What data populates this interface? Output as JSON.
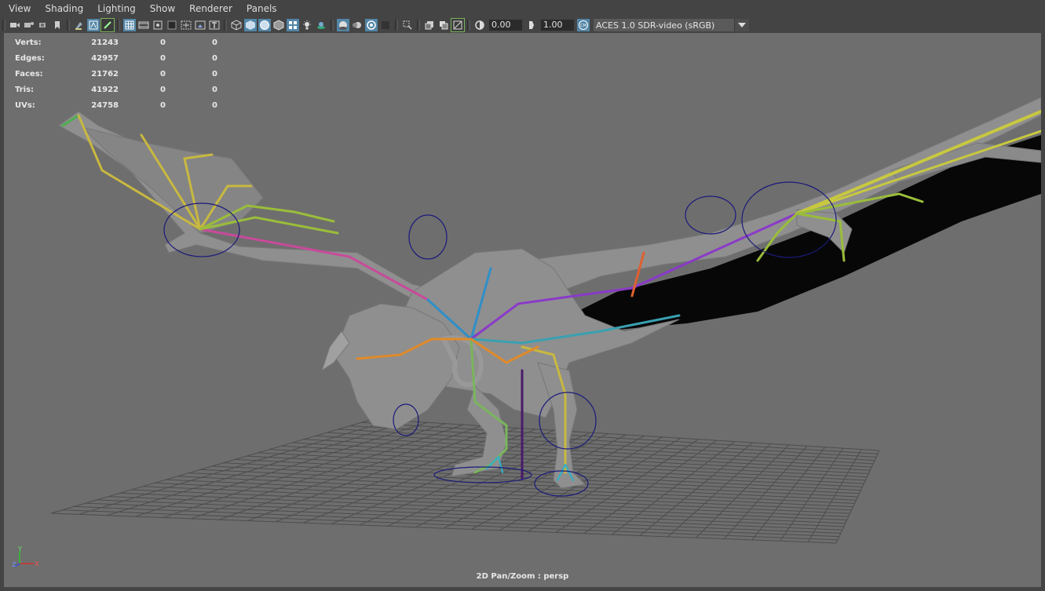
{
  "menubar": {
    "items": [
      "View",
      "Shading",
      "Lighting",
      "Show",
      "Renderer",
      "Panels"
    ]
  },
  "toolbar": {
    "icons": [
      "select-camera-icon",
      "camera-attributes-icon",
      "bookmark-icon",
      "image-plane-icon",
      "2d-pan-zoom-icon",
      "grease-pencil-icon",
      "grid-icon",
      "film-gate-icon",
      "resolution-gate-icon",
      "gate-mask-icon",
      "field-chart-icon",
      "safe-action-icon",
      "safe-title-icon",
      "wireframe-icon",
      "smooth-shade-icon",
      "wireframe-on-shaded-icon",
      "bounding-box-icon",
      "textured-icon",
      "use-all-lights-icon",
      "shadows-icon",
      "screen-space-ambient-occlusion-icon",
      "motion-blur-icon",
      "multisample-anti-aliasing-icon",
      "depth-of-field-icon",
      "isolate-select-icon",
      "xray-icon",
      "xray-active-components-icon",
      "xray-joints-icon",
      "exposure-icon",
      "gamma-icon",
      "color-management-icon"
    ],
    "exposure_value": "0.00",
    "gamma_value": "1.00",
    "color_space": "ACES 1.0 SDR-video (sRGB)"
  },
  "hud": {
    "rows": [
      {
        "label": "Verts:",
        "values": [
          "21243",
          "0",
          "0"
        ]
      },
      {
        "label": "Edges:",
        "values": [
          "42957",
          "0",
          "0"
        ]
      },
      {
        "label": "Faces:",
        "values": [
          "21762",
          "0",
          "0"
        ]
      },
      {
        "label": "Tris:",
        "values": [
          "41922",
          "0",
          "0"
        ]
      },
      {
        "label": "UVs:",
        "values": [
          "24758",
          "0",
          "0"
        ]
      }
    ]
  },
  "axis": {
    "x": "X",
    "y": "Y",
    "z": "Z"
  },
  "status": "2D Pan/Zoom : persp",
  "colors": {
    "ui_bg": "#444444",
    "viewport_bg": "#6e6e6e",
    "highlight": "#5285a6",
    "mesh": "#8a8a8a",
    "control_curve": "#1a1a7a"
  }
}
